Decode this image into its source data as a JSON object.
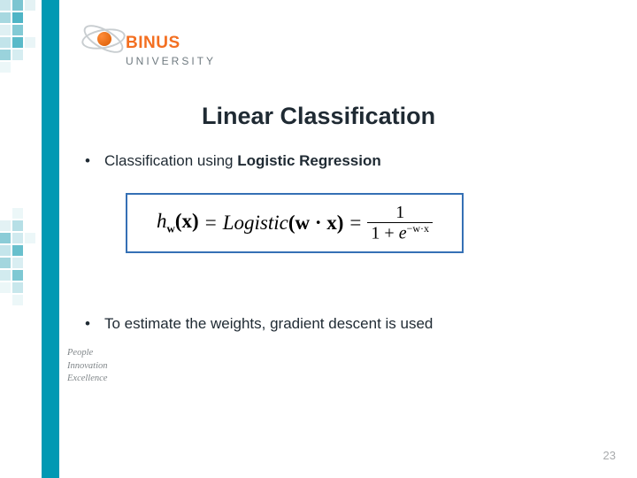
{
  "brand": {
    "name": "BINUS",
    "subtitle": "UNIVERSITY"
  },
  "colors": {
    "teal": "#0099b3",
    "orange": "#f36f21",
    "grey": "#808689"
  },
  "title": "Linear Classification",
  "bullets": [
    {
      "pretext": "Classification using ",
      "strong": "Logistic Regression"
    },
    {
      "pretext": "To estimate the weights, gradient descent is used",
      "strong": ""
    }
  ],
  "formula": {
    "lhs_h": "h",
    "lhs_sub": "w",
    "lhs_arg": "(x)",
    "eq": "=",
    "func": "Logistic",
    "mid_arg": "(w · x)",
    "rhs_num": "1",
    "rhs_den_prefix": "1 + ",
    "rhs_den_base": "e",
    "rhs_den_exp": "−w·x"
  },
  "tagline": [
    "People",
    "Innovation",
    "Excellence"
  ],
  "page": "23",
  "deco_top": [
    {
      "l": 0,
      "t": 0,
      "w": 12,
      "h": 12,
      "c": "#cbe7ec"
    },
    {
      "l": 14,
      "t": 0,
      "w": 12,
      "h": 12,
      "c": "#7cc5d1"
    },
    {
      "l": 28,
      "t": 0,
      "w": 12,
      "h": 12,
      "c": "#e4f2f4"
    },
    {
      "l": 0,
      "t": 14,
      "w": 12,
      "h": 12,
      "c": "#a7d8e0"
    },
    {
      "l": 14,
      "t": 14,
      "w": 12,
      "h": 12,
      "c": "#4fb5c6"
    },
    {
      "l": 0,
      "t": 28,
      "w": 12,
      "h": 12,
      "c": "#dff0f3"
    },
    {
      "l": 14,
      "t": 28,
      "w": 12,
      "h": 12,
      "c": "#83cad5"
    },
    {
      "l": 0,
      "t": 42,
      "w": 12,
      "h": 12,
      "c": "#c2e4ea"
    },
    {
      "l": 14,
      "t": 42,
      "w": 12,
      "h": 12,
      "c": "#5abac9"
    },
    {
      "l": 28,
      "t": 42,
      "w": 12,
      "h": 12,
      "c": "#e9f5f7"
    },
    {
      "l": 0,
      "t": 56,
      "w": 12,
      "h": 12,
      "c": "#9ad3dc"
    },
    {
      "l": 14,
      "t": 56,
      "w": 12,
      "h": 12,
      "c": "#d6edf1"
    },
    {
      "l": 0,
      "t": 70,
      "w": 12,
      "h": 12,
      "c": "#ecf7f8"
    }
  ],
  "deco_bottom": [
    {
      "l": 14,
      "t": 0,
      "w": 12,
      "h": 12,
      "c": "#ecf7f8"
    },
    {
      "l": 14,
      "t": 14,
      "w": 12,
      "h": 12,
      "c": "#b6dfe6"
    },
    {
      "l": 0,
      "t": 14,
      "w": 12,
      "h": 12,
      "c": "#e3f2f4"
    },
    {
      "l": 0,
      "t": 28,
      "w": 12,
      "h": 12,
      "c": "#8bccd7"
    },
    {
      "l": 14,
      "t": 28,
      "w": 12,
      "h": 12,
      "c": "#d0eaef"
    },
    {
      "l": 28,
      "t": 28,
      "w": 12,
      "h": 12,
      "c": "#ecf7f8"
    },
    {
      "l": 0,
      "t": 42,
      "w": 12,
      "h": 12,
      "c": "#c4e5eb"
    },
    {
      "l": 14,
      "t": 42,
      "w": 12,
      "h": 12,
      "c": "#69c0cd"
    },
    {
      "l": 0,
      "t": 56,
      "w": 12,
      "h": 12,
      "c": "#a3d6de"
    },
    {
      "l": 14,
      "t": 56,
      "w": 12,
      "h": 12,
      "c": "#d9eef2"
    },
    {
      "l": 0,
      "t": 70,
      "w": 12,
      "h": 12,
      "c": "#d2ebef"
    },
    {
      "l": 14,
      "t": 70,
      "w": 12,
      "h": 12,
      "c": "#7ec8d3"
    },
    {
      "l": 0,
      "t": 84,
      "w": 12,
      "h": 12,
      "c": "#ecf7f8"
    },
    {
      "l": 14,
      "t": 84,
      "w": 12,
      "h": 12,
      "c": "#c8e7ec"
    },
    {
      "l": 14,
      "t": 98,
      "w": 12,
      "h": 12,
      "c": "#ecf7f8"
    }
  ]
}
